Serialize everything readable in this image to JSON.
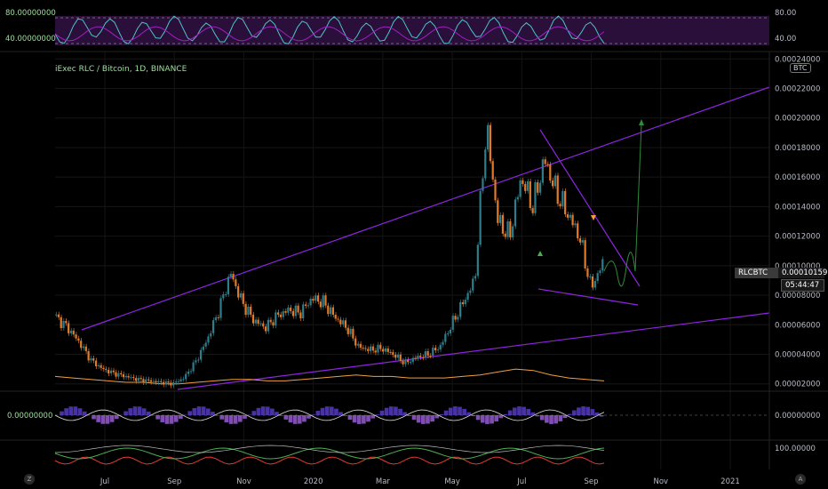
{
  "title": "iExec RLC / Bitcoin, 1D, BINANCE",
  "currency_badge": "BTC",
  "symbol_tag": "RLCBTC",
  "price_tag": "0.00010159",
  "countdown_tag": "05:44:47",
  "z_button": "Z",
  "a_button": "A",
  "rsi_panel": {
    "left_labels": [
      "80.00000000",
      "40.00000000"
    ],
    "right_labels": [
      "80.00",
      "40.00"
    ],
    "levels": [
      80,
      40
    ]
  },
  "macd_panel": {
    "left_label": "0.00000000",
    "right_label": "0.00000000"
  },
  "bottom_panel": {
    "right_label": "100.00000"
  },
  "colors": {
    "accent_green": "#4caf50",
    "candle_bull": "#2e7d8a",
    "candle_bear": "#e07b2b",
    "trendline": "#8e24e0",
    "ma_line": "#f0a040",
    "rsi_fill": "#2a0f3a"
  },
  "chart_data": {
    "type": "line",
    "series": [
      {
        "name": "",
        "values": [
          6.5e-05,
          5.8e-05,
          4.8e-05,
          3.6e-05,
          3e-05,
          2.7e-05,
          2.5e-05,
          2.3e-05,
          2.2e-05,
          2.1e-05,
          2e-05,
          2.4e-05,
          3.5e-05,
          5e-05,
          7e-05,
          9.5e-05,
          7.5e-05,
          6.3e-05,
          5.8e-05,
          6.6e-05,
          7e-05,
          6.8e-05,
          7.8e-05,
          7.5e-05,
          6.5e-05,
          5.8e-05,
          4.5e-05,
          4.3e-05,
          4.4e-05,
          4e-05,
          3.4e-05,
          3.8e-05,
          4e-05,
          4.5e-05,
          6e-05,
          7.5e-05,
          9e-05,
          0.000195,
          0.00013,
          0.00012,
          0.00016,
          0.00014,
          0.000172,
          0.00015,
          0.000135,
          0.00012,
          8.5e-05,
          0.000101
        ]
      },
      {
        "name": "",
        "values": [
          2.5e-05,
          2.4e-05,
          2.3e-05,
          2.2e-05,
          2.1e-05,
          2.1e-05,
          2e-05,
          2e-05,
          2.1e-05,
          2.2e-05,
          2.3e-05,
          2.3e-05,
          2.2e-05,
          2.2e-05,
          2.3e-05,
          2.4e-05,
          2.5e-05,
          2.6e-05,
          2.5e-05,
          2.5e-05,
          2.4e-05,
          2.4e-05,
          2.4e-05,
          2.5e-05,
          2.6e-05,
          2.8e-05,
          3e-05,
          2.9e-05,
          2.6e-05,
          2.4e-05,
          2.3e-05,
          2.2e-05
        ]
      }
    ],
    "x_ticks": [
      "Jul",
      "Sep",
      "Nov",
      "2020",
      "Mar",
      "May",
      "Jul",
      "Sep",
      "Nov",
      "2021"
    ],
    "y_ticks": [
      "0.00002000",
      "0.00004000",
      "0.00006000",
      "0.00008000",
      "0.00010000",
      "0.00012000",
      "0.00014000",
      "0.00016000",
      "0.00018000",
      "0.00020000",
      "0.00022000",
      "0.00024000"
    ],
    "ylim": [
      1.5e-05,
      0.000245
    ],
    "grid": true,
    "scale": "linear"
  }
}
